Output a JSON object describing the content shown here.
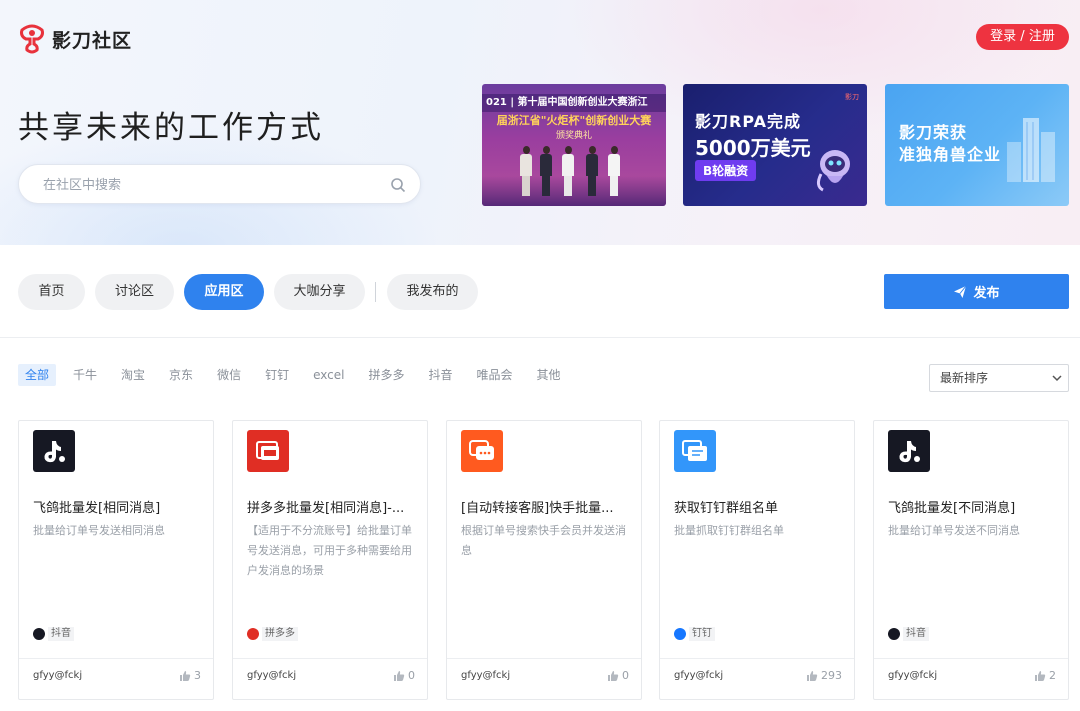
{
  "header": {
    "logo_text": "影刀社区",
    "login_label": "登录 / 注册"
  },
  "hero": {
    "title": "共享未来的工作方式",
    "search_placeholder": "在社区中搜索"
  },
  "banners": [
    {
      "headline": "021 | 第十届中国创新创业大赛浙江",
      "subline": "届浙江省\"火炬杯\"创新创业大赛",
      "subline2": "颁奖典礼"
    },
    {
      "title": "影刀RPA完成",
      "amount": "5000万美元",
      "tag": "B轮融资",
      "brand": "影刀"
    },
    {
      "title_line1": "影刀荣获",
      "title_line2": "准独角兽企业"
    }
  ],
  "nav": {
    "tabs": [
      "首页",
      "讨论区",
      "应用区",
      "大咖分享",
      "我发布的"
    ],
    "active_tab": "应用区",
    "publish_label": "发布"
  },
  "filters": {
    "items": [
      "全部",
      "千牛",
      "淘宝",
      "京东",
      "微信",
      "钉钉",
      "excel",
      "拼多多",
      "抖音",
      "唯品会",
      "其他"
    ],
    "active": "全部",
    "sort_label": "最新排序"
  },
  "cards": [
    {
      "icon": "douyin-icon",
      "title": "飞鸽批量发[相同消息]",
      "desc": "批量给订单号发送相同消息",
      "tag": "抖音",
      "author": "gfyy@fckj",
      "likes": "3"
    },
    {
      "icon": "pinduoduo-icon",
      "title": "拼多多批量发[相同消息]-...",
      "desc": "【适用于不分流账号】给批量订单号发送消息，可用于多种需要给用户发消息的场景",
      "tag": "拼多多",
      "author": "gfyy@fckj",
      "likes": "0"
    },
    {
      "icon": "kuaishou-service-icon",
      "title": "[自动转接客服]快手批量...",
      "desc": "根据订单号搜索快手会员并发送消息",
      "tag": "",
      "author": "gfyy@fckj",
      "likes": "0"
    },
    {
      "icon": "dingtalk-icon",
      "title": "获取钉钉群组名单",
      "desc": "批量抓取钉钉群组名单",
      "tag": "钉钉",
      "author": "gfyy@fckj",
      "likes": "293"
    },
    {
      "icon": "douyin-icon",
      "title": "飞鸽批量发[不同消息]",
      "desc": "批量给订单号发送不同消息",
      "tag": "抖音",
      "author": "gfyy@fckj",
      "likes": "2"
    }
  ],
  "colors": {
    "accent": "#2f82ee",
    "login": "#ee3340",
    "douyin": "#161823",
    "pinduoduo": "#e02e24",
    "kuaishou": "#ff5a1f",
    "dingtalk": "#3296fa"
  }
}
